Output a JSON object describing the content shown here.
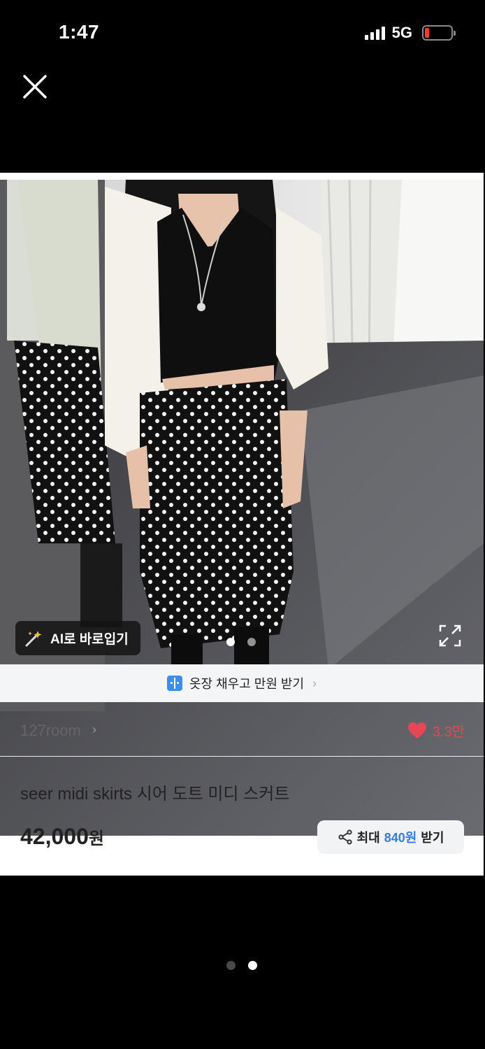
{
  "status_bar": {
    "time": "1:47",
    "network": "5G",
    "battery_level": 0.1,
    "battery_color": "#ff3b30"
  },
  "icons": {
    "close": "close-icon",
    "ai": "magic-wand-icon",
    "expand": "expand-icon",
    "promo": "wallet-icon",
    "heart": "heart-icon",
    "share": "share-icon"
  },
  "photo": {
    "ai_button_label": "AI로 바로입기",
    "carousel_count": 2,
    "carousel_active": 1
  },
  "promo": {
    "text": "옷장 채우고 만원 받기",
    "chevron": "›"
  },
  "shop": {
    "name": "127room",
    "chevron": "›",
    "likes": "3.3만",
    "like_color": "#e84557"
  },
  "product": {
    "title": "seer midi skirts 시어 도트 미디 스커트",
    "price": "42,000",
    "price_unit": "원"
  },
  "share": {
    "prefix": "최대 ",
    "amount": "840원",
    "suffix": " 받기",
    "highlight_color": "#3a7be0"
  },
  "pager": {
    "count": 2,
    "active": 2
  }
}
